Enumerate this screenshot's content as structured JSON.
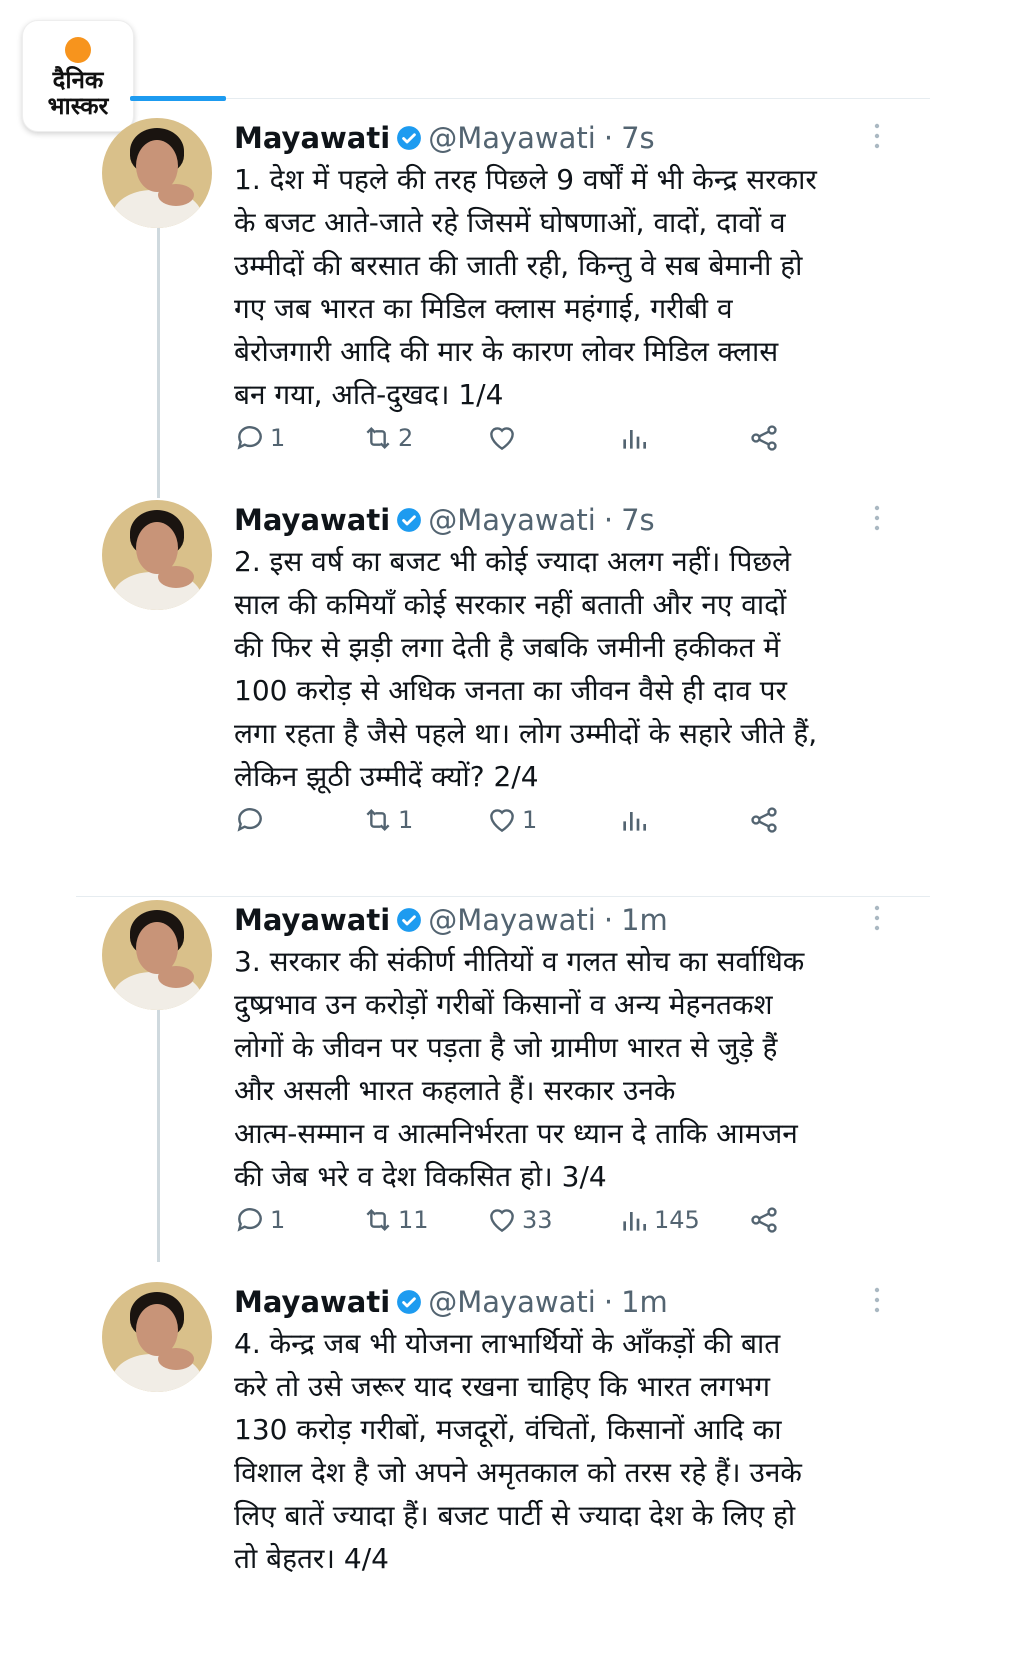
{
  "logo": {
    "line1": "दैनिक",
    "line2": "भास्कर"
  },
  "tweets": [
    {
      "name": "Mayawati",
      "handle": "@Mayawati",
      "time": "7s",
      "text": "1. देश में पहले की तरह पिछले 9 वर्षों में भी केन्द्र सरकार\nके बजट आते-जाते रहे जिसमें घोषणाओं, वादों, दावों व\nउम्मीदों की बरसात की जाती रही, किन्तु वे सब बेमानी हो\nगए जब भारत का मिडिल क्लास महंगाई, गरीबी व\nबेरोजगारी आदि की मार के कारण लोवर मिडिल क्लास\nबन गया, अति-दुखद। 1/4",
      "replies": "1",
      "retweets": "2",
      "likes": "",
      "views": ""
    },
    {
      "name": "Mayawati",
      "handle": "@Mayawati",
      "time": "7s",
      "text": "2. इस वर्ष का बजट भी कोई ज्यादा अलग नहीं। पिछले\nसाल की कमियाँ कोई सरकार नहीं बताती और नए वादों\nकी फिर से झड़ी लगा देती है जबकि जमीनी हकीकत में\n100 करोड़ से अधिक जनता का जीवन वैसे ही दाव पर\nलगा रहता है जैसे पहले था। लोग उम्मीदों के सहारे जीते हैं,\nलेकिन झूठी उम्मीदें क्यों? 2/4",
      "replies": "",
      "retweets": "1",
      "likes": "1",
      "views": ""
    },
    {
      "name": "Mayawati",
      "handle": "@Mayawati",
      "time": "1m",
      "text": "3. सरकार की संकीर्ण नीतियों व गलत सोच का सर्वाधिक\nदुष्प्रभाव उन करोड़ों गरीबों  किसानों व अन्य मेहनतकश\nलोगों के जीवन पर पड़ता है जो ग्रामीण भारत से जुड़े हैं\nऔर असली भारत कहलाते हैं। सरकार उनके\nआत्म-सम्मान व आत्मनिर्भरता पर ध्यान दे ताकि आमजन\nकी जेब भरे व देश विकसित हो। 3/4",
      "replies": "1",
      "retweets": "11",
      "likes": "33",
      "views": "145"
    },
    {
      "name": "Mayawati",
      "handle": "@Mayawati",
      "time": "1m",
      "text": "4. केन्द्र जब भी योजना लाभार्थियों के आँकड़ों की बात\nकरे तो उसे जरूर याद रखना चाहिए कि भारत लगभग\n130 करोड़ गरीबों, मजदूरों, वंचितों, किसानों आदि का\nविशाल देश है जो अपने अमृतकाल को तरस रहे हैं। उनके\nलिए बातें ज्यादा हैं। बजट पार्टी से ज्यादा देश के लिए हो\nतो बेहतर। 4/4",
      "replies": "",
      "retweets": "",
      "likes": "",
      "views": ""
    }
  ],
  "colors": {
    "accent": "#1d9bf0",
    "muted": "#536471",
    "thread": "#cfd9de"
  }
}
